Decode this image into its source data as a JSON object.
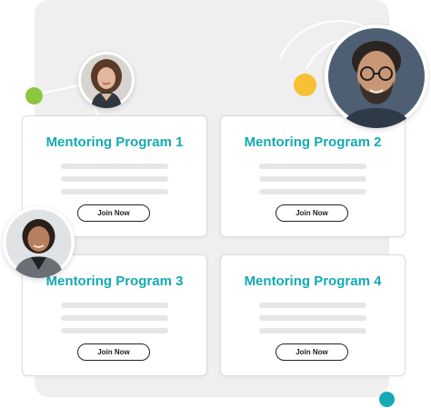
{
  "colors": {
    "accent_teal": "#14a9b4",
    "dot_green": "#8dc63f",
    "dot_yellow": "#f7c035",
    "backdrop": "#efefef"
  },
  "programs": [
    {
      "title": "Mentoring Program 1",
      "button_label": "Join Now"
    },
    {
      "title": "Mentoring Program 2",
      "button_label": "Join Now"
    },
    {
      "title": "Mentoring Program 3",
      "button_label": "Join Now"
    },
    {
      "title": "Mentoring Program 4",
      "button_label": "Join Now"
    }
  ],
  "avatars": [
    {
      "name": "mentor-avatar-woman-curly-hair"
    },
    {
      "name": "mentor-avatar-man-glasses"
    },
    {
      "name": "mentor-avatar-woman-blazer"
    }
  ]
}
